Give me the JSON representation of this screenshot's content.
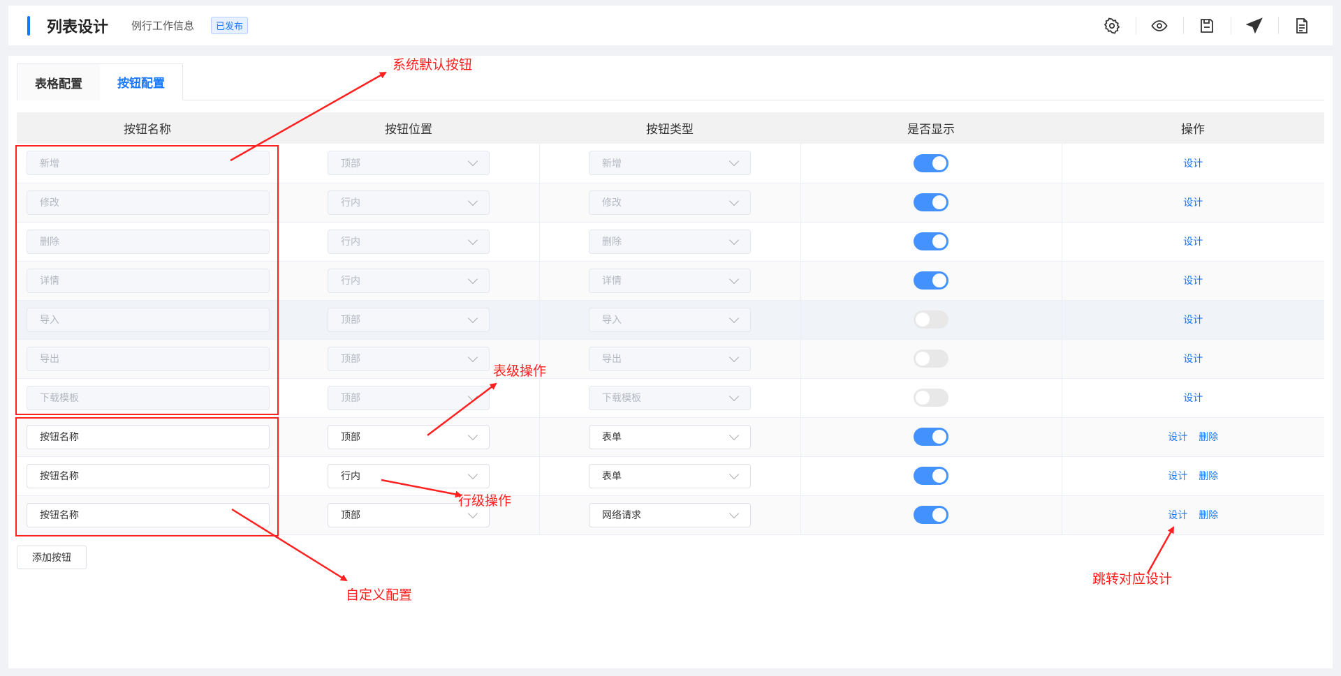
{
  "header": {
    "title": "列表设计",
    "subtitle": "例行工作信息",
    "badge": "已发布",
    "tools": [
      "gear-icon",
      "eye-icon",
      "save-icon",
      "send-icon",
      "document-icon"
    ]
  },
  "tabs": [
    {
      "label": "表格配置",
      "active": false
    },
    {
      "label": "按钮配置",
      "active": true
    }
  ],
  "table": {
    "columns": [
      "按钮名称",
      "按钮位置",
      "按钮类型",
      "是否显示",
      "操作"
    ],
    "rows": [
      {
        "name": "新增",
        "position": "顶部",
        "type": "新增",
        "shown": true,
        "system": true
      },
      {
        "name": "修改",
        "position": "行内",
        "type": "修改",
        "shown": true,
        "system": true
      },
      {
        "name": "删除",
        "position": "行内",
        "type": "删除",
        "shown": true,
        "system": true
      },
      {
        "name": "详情",
        "position": "行内",
        "type": "详情",
        "shown": true,
        "system": true
      },
      {
        "name": "导入",
        "position": "顶部",
        "type": "导入",
        "shown": false,
        "system": true
      },
      {
        "name": "导出",
        "position": "顶部",
        "type": "导出",
        "shown": false,
        "system": true
      },
      {
        "name": "下载模板",
        "position": "顶部",
        "type": "下载模板",
        "shown": false,
        "system": true
      },
      {
        "name": "按钮名称",
        "position": "顶部",
        "type": "表单",
        "shown": true,
        "system": false
      },
      {
        "name": "按钮名称",
        "position": "行内",
        "type": "表单",
        "shown": true,
        "system": false
      },
      {
        "name": "按钮名称",
        "position": "顶部",
        "type": "网络请求",
        "shown": true,
        "system": false
      }
    ],
    "action_design": "设计",
    "action_delete": "删除"
  },
  "add_button": "添加按钮",
  "annotations": {
    "system_default": "系统默认按钮",
    "table_level": "表级操作",
    "row_level": "行级操作",
    "custom_config": "自定义配置",
    "jump_design": "跳转对应设计"
  },
  "colors": {
    "accent": "#1677ff",
    "annotation": "#ff1e1e"
  }
}
